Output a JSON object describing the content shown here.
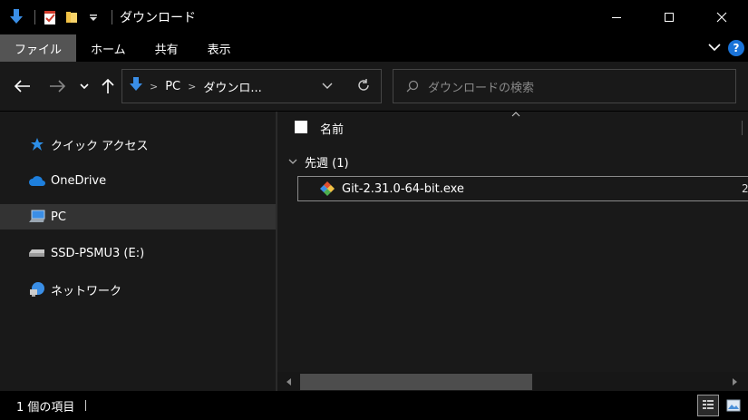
{
  "window": {
    "title": "ダウンロード"
  },
  "ribbon": {
    "tabs": [
      {
        "label": "ファイル"
      },
      {
        "label": "ホーム"
      },
      {
        "label": "共有"
      },
      {
        "label": "表示"
      }
    ]
  },
  "address": {
    "crumbs": [
      "PC",
      "ダウンロ..."
    ]
  },
  "search": {
    "placeholder": "ダウンロードの検索"
  },
  "nav": {
    "items": [
      {
        "label": "クイック アクセス"
      },
      {
        "label": "OneDrive"
      },
      {
        "label": "PC"
      },
      {
        "label": "SSD-PSMU3 (E:)"
      },
      {
        "label": "ネットワーク"
      }
    ]
  },
  "content": {
    "column_name": "名前",
    "group_label": "先週 (1)",
    "files": [
      {
        "name": "Git-2.31.0-64-bit.exe",
        "trailing": "2"
      }
    ]
  },
  "status": {
    "item_count": "1 個の項目"
  },
  "colors": {
    "accent_blue": "#1a73d8",
    "bg_dark": "#191919",
    "selected": "#333333"
  }
}
